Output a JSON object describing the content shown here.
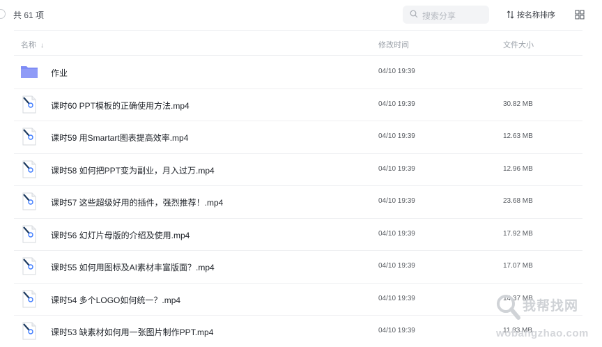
{
  "toolbar": {
    "item_count": "共 61 项",
    "search_placeholder": "搜索分享",
    "sort_label": "按名称排序"
  },
  "columns": {
    "name": "名称",
    "name_sort_arrow": "↓",
    "modified": "修改时间",
    "size": "文件大小"
  },
  "files": [
    {
      "name": "作业",
      "time": "04/10 19:39",
      "size": "",
      "type": "folder-icon"
    },
    {
      "name": "课时60 PPT模板的正确使用方法.mp4",
      "time": "04/10 19:39",
      "size": "30.82 MB",
      "type": "video-file-icon"
    },
    {
      "name": "课时59 用Smartart图表提高效率.mp4",
      "time": "04/10 19:39",
      "size": "12.63 MB",
      "type": "video-file-icon"
    },
    {
      "name": "课时58 如何把PPT变为副业，月入过万.mp4",
      "time": "04/10 19:39",
      "size": "12.96 MB",
      "type": "video-file-icon"
    },
    {
      "name": "课时57 这些超级好用的插件，强烈推荐！.mp4",
      "time": "04/10 19:39",
      "size": "23.68 MB",
      "type": "video-file-icon"
    },
    {
      "name": "课时56 幻灯片母版的介绍及使用.mp4",
      "time": "04/10 19:39",
      "size": "17.92 MB",
      "type": "video-file-icon"
    },
    {
      "name": "课时55 如何用图标及AI素材丰富版面？.mp4",
      "time": "04/10 19:39",
      "size": "17.07 MB",
      "type": "video-file-icon"
    },
    {
      "name": "课时54 多个LOGO如何统一？.mp4",
      "time": "04/10 19:39",
      "size": "14.37 MB",
      "type": "video-file-icon"
    },
    {
      "name": "课时53 缺素材如何用一张图片制作PPT.mp4",
      "time": "04/10 19:39",
      "size": "11.83 MB",
      "type": "video-file-icon"
    }
  ],
  "watermark": {
    "text": "我帮找网",
    "url": "wobangzhao.com"
  },
  "colors": {
    "folder": "#7e8cf5",
    "accent": "#3d7bff"
  }
}
